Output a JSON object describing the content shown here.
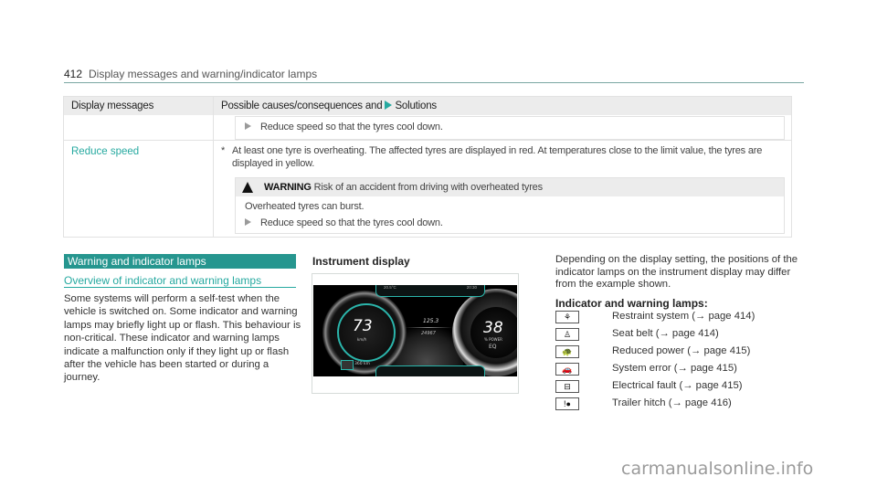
{
  "header": {
    "page_number": "412",
    "title": "Display messages and warning/indicator lamps"
  },
  "table": {
    "col1_header": "Display messages",
    "col2_header_prefix": "Possible causes/consequences and",
    "col2_header_suffix": "Solutions",
    "continued_row": {
      "step": "Reduce speed so that the tyres cool down."
    },
    "row": {
      "message": "Reduce speed",
      "cause_marker": "*",
      "cause": "At least one tyre is overheating. The affected tyres are displayed in red. At temperatures close to the limit value, the tyres are displayed in yellow.",
      "warning": {
        "label": "WARNING",
        "title": "Risk of an accident from driving with overheated tyres",
        "body": "Overheated tyres can burst.",
        "step": "Reduce speed so that the tyres cool down."
      }
    }
  },
  "left": {
    "section_title": "Warning and indicator lamps",
    "subsection_title": "Overview of indicator and warning lamps",
    "paragraph": "Some systems will perform a self-test when the vehicle is switched on. Some indicator and warning lamps may briefly light up or flash. This behaviour is non-critical. These indicator and warning lamps indicate a malfunction only if they light up or flash after the vehicle has been started or during a journey."
  },
  "middle": {
    "heading": "Instrument display",
    "cluster": {
      "outside_temp": "20.5°C",
      "clock": "20:30",
      "speed": "73",
      "speed_unit": "km/h",
      "trip": "125.3",
      "odometer": "24967",
      "power": "38",
      "power_unit": "% POWER",
      "mode": "EQ",
      "range": "360 km"
    }
  },
  "right": {
    "paragraph": "Depending on the display setting, the positions of the indicator lamps on the instrument display may differ from the example shown.",
    "lamps_heading": "Indicator and warning lamps:",
    "lamps": [
      {
        "icon": "restraint-system-icon",
        "glyph": "⚘",
        "label": "Restraint system (→ page 414)"
      },
      {
        "icon": "seat-belt-icon",
        "glyph": "♙",
        "label": "Seat belt (→ page 414)"
      },
      {
        "icon": "reduced-power-icon",
        "glyph": "🐢",
        "label": "Reduced power (→ page 415)"
      },
      {
        "icon": "system-error-icon",
        "glyph": "🚗",
        "label": "System error (→ page 415)"
      },
      {
        "icon": "electrical-fault-icon",
        "glyph": "⊟",
        "label": "Electrical fault (→ page 415)"
      },
      {
        "icon": "trailer-hitch-icon",
        "glyph": "!●",
        "label": "Trailer hitch (→ page 416)"
      }
    ]
  },
  "watermark": "carmanualsonline.info",
  "colors": {
    "accent": "#26a9a0",
    "section_bar": "#26968f",
    "table_header_bg": "#ececec"
  }
}
